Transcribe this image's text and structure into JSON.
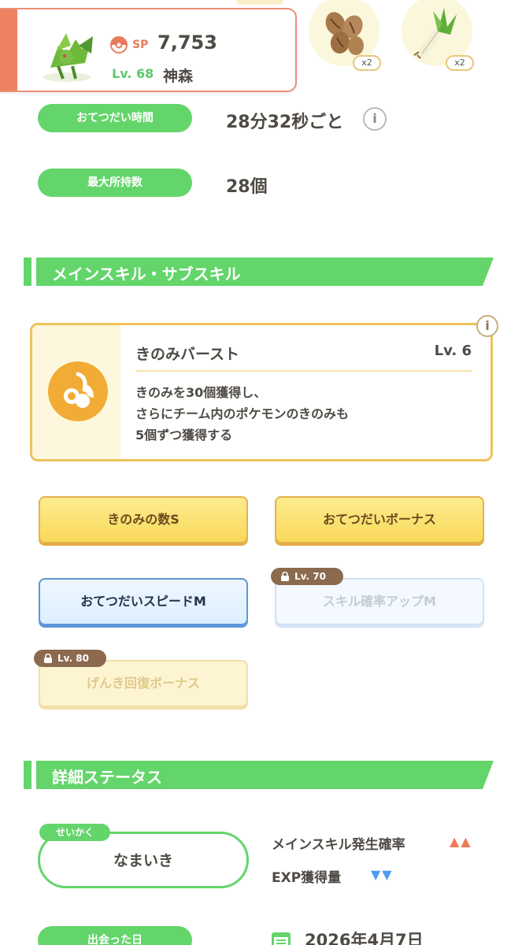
{
  "header": {
    "sp_label": "SP",
    "sp_value": "7,753",
    "level": "Lv. 68",
    "name": "神森"
  },
  "ingredients": [
    {
      "icon": "coffee-beans-icon",
      "count": "x2"
    },
    {
      "icon": "leek-icon",
      "count": "x2"
    }
  ],
  "stats": {
    "help_time_label": "おてつだい時間",
    "help_time_value": "28分32秒ごと",
    "max_carry_label": "最大所持数",
    "max_carry_value": "28個"
  },
  "skills_section": {
    "title": "メインスキル・サブスキル"
  },
  "main_skill": {
    "icon": "berry-burst-icon",
    "name": "きのみバースト",
    "level": "Lv. 6",
    "desc_line1": "きのみを30個獲得し、",
    "desc_line2": "さらにチーム内のポケモンのきのみも",
    "desc_line3": "5個ずつ獲得する"
  },
  "subskills": [
    {
      "label": "きのみの数S",
      "locked": false
    },
    {
      "label": "おてつだいボーナス",
      "locked": false
    },
    {
      "label": "おてつだいスピードM",
      "locked": false
    },
    {
      "label": "スキル確率アップM",
      "locked": true,
      "lock_level": "Lv. 70"
    },
    {
      "label": "げんき回復ボーナス",
      "locked": true,
      "lock_level": "Lv. 80"
    }
  ],
  "details_section": {
    "title": "詳細ステータス"
  },
  "nature": {
    "tag": "せいかく",
    "value": "なまいき",
    "effect_up_label": "メインスキル発生確率",
    "effect_up_arrows": "▲▲",
    "effect_down_label": "EXP獲得量",
    "effect_down_arrows": "▼▼"
  },
  "met": {
    "label": "出会った日",
    "date": "2026年4月7日"
  },
  "colors": {
    "green": "#63d56b",
    "coral": "#ee8161",
    "gold": "#efc25a",
    "blue": "#5f95d8"
  }
}
